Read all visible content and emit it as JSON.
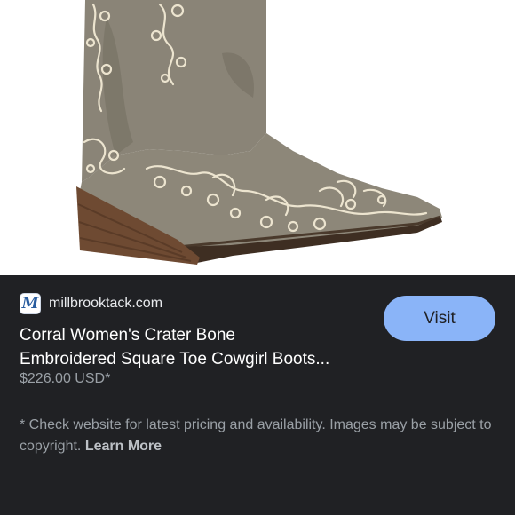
{
  "image": {
    "icon": "cowgirl-boot-product-photo"
  },
  "source": {
    "favicon_letter": "M",
    "domain": "millbrooktack.com"
  },
  "visit_label": "Visit",
  "product": {
    "title_line1": "Corral Women's Crater Bone",
    "title_line2": "Embroidered Square Toe Cowgirl Boots...",
    "price": "$226.00 USD*"
  },
  "disclaimer": {
    "text": "* Check website for latest pricing and availability. Images may be subject to copyright. ",
    "link": "Learn More"
  },
  "colors": {
    "panel_bg": "#202124",
    "button_bg": "#8ab4f8",
    "secondary_text": "#9aa0a6"
  }
}
